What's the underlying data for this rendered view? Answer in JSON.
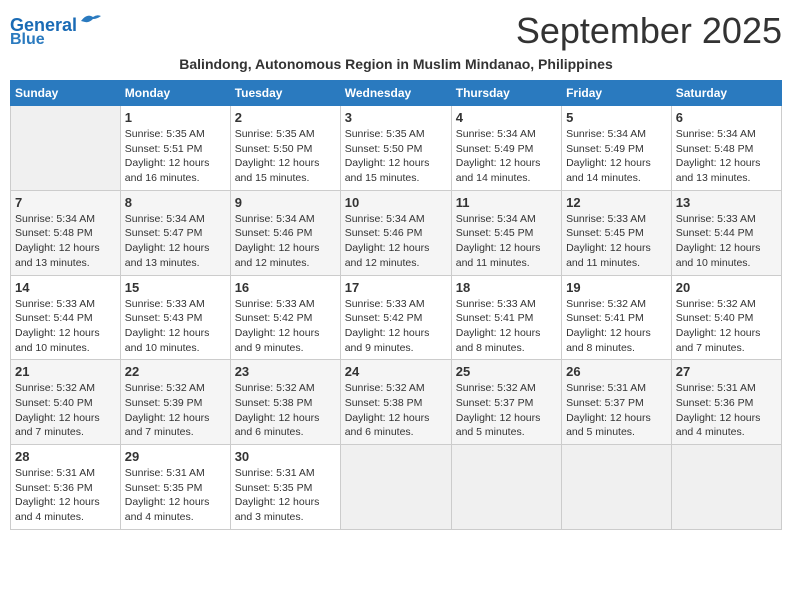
{
  "header": {
    "logo_line1": "General",
    "logo_line2": "Blue",
    "month_title": "September 2025",
    "subtitle": "Balindong, Autonomous Region in Muslim Mindanao, Philippines"
  },
  "weekdays": [
    "Sunday",
    "Monday",
    "Tuesday",
    "Wednesday",
    "Thursday",
    "Friday",
    "Saturday"
  ],
  "weeks": [
    [
      {
        "day": "",
        "info": ""
      },
      {
        "day": "1",
        "info": "Sunrise: 5:35 AM\nSunset: 5:51 PM\nDaylight: 12 hours\nand 16 minutes."
      },
      {
        "day": "2",
        "info": "Sunrise: 5:35 AM\nSunset: 5:50 PM\nDaylight: 12 hours\nand 15 minutes."
      },
      {
        "day": "3",
        "info": "Sunrise: 5:35 AM\nSunset: 5:50 PM\nDaylight: 12 hours\nand 15 minutes."
      },
      {
        "day": "4",
        "info": "Sunrise: 5:34 AM\nSunset: 5:49 PM\nDaylight: 12 hours\nand 14 minutes."
      },
      {
        "day": "5",
        "info": "Sunrise: 5:34 AM\nSunset: 5:49 PM\nDaylight: 12 hours\nand 14 minutes."
      },
      {
        "day": "6",
        "info": "Sunrise: 5:34 AM\nSunset: 5:48 PM\nDaylight: 12 hours\nand 13 minutes."
      }
    ],
    [
      {
        "day": "7",
        "info": "Sunrise: 5:34 AM\nSunset: 5:48 PM\nDaylight: 12 hours\nand 13 minutes."
      },
      {
        "day": "8",
        "info": "Sunrise: 5:34 AM\nSunset: 5:47 PM\nDaylight: 12 hours\nand 13 minutes."
      },
      {
        "day": "9",
        "info": "Sunrise: 5:34 AM\nSunset: 5:46 PM\nDaylight: 12 hours\nand 12 minutes."
      },
      {
        "day": "10",
        "info": "Sunrise: 5:34 AM\nSunset: 5:46 PM\nDaylight: 12 hours\nand 12 minutes."
      },
      {
        "day": "11",
        "info": "Sunrise: 5:34 AM\nSunset: 5:45 PM\nDaylight: 12 hours\nand 11 minutes."
      },
      {
        "day": "12",
        "info": "Sunrise: 5:33 AM\nSunset: 5:45 PM\nDaylight: 12 hours\nand 11 minutes."
      },
      {
        "day": "13",
        "info": "Sunrise: 5:33 AM\nSunset: 5:44 PM\nDaylight: 12 hours\nand 10 minutes."
      }
    ],
    [
      {
        "day": "14",
        "info": "Sunrise: 5:33 AM\nSunset: 5:44 PM\nDaylight: 12 hours\nand 10 minutes."
      },
      {
        "day": "15",
        "info": "Sunrise: 5:33 AM\nSunset: 5:43 PM\nDaylight: 12 hours\nand 10 minutes."
      },
      {
        "day": "16",
        "info": "Sunrise: 5:33 AM\nSunset: 5:42 PM\nDaylight: 12 hours\nand 9 minutes."
      },
      {
        "day": "17",
        "info": "Sunrise: 5:33 AM\nSunset: 5:42 PM\nDaylight: 12 hours\nand 9 minutes."
      },
      {
        "day": "18",
        "info": "Sunrise: 5:33 AM\nSunset: 5:41 PM\nDaylight: 12 hours\nand 8 minutes."
      },
      {
        "day": "19",
        "info": "Sunrise: 5:32 AM\nSunset: 5:41 PM\nDaylight: 12 hours\nand 8 minutes."
      },
      {
        "day": "20",
        "info": "Sunrise: 5:32 AM\nSunset: 5:40 PM\nDaylight: 12 hours\nand 7 minutes."
      }
    ],
    [
      {
        "day": "21",
        "info": "Sunrise: 5:32 AM\nSunset: 5:40 PM\nDaylight: 12 hours\nand 7 minutes."
      },
      {
        "day": "22",
        "info": "Sunrise: 5:32 AM\nSunset: 5:39 PM\nDaylight: 12 hours\nand 7 minutes."
      },
      {
        "day": "23",
        "info": "Sunrise: 5:32 AM\nSunset: 5:38 PM\nDaylight: 12 hours\nand 6 minutes."
      },
      {
        "day": "24",
        "info": "Sunrise: 5:32 AM\nSunset: 5:38 PM\nDaylight: 12 hours\nand 6 minutes."
      },
      {
        "day": "25",
        "info": "Sunrise: 5:32 AM\nSunset: 5:37 PM\nDaylight: 12 hours\nand 5 minutes."
      },
      {
        "day": "26",
        "info": "Sunrise: 5:31 AM\nSunset: 5:37 PM\nDaylight: 12 hours\nand 5 minutes."
      },
      {
        "day": "27",
        "info": "Sunrise: 5:31 AM\nSunset: 5:36 PM\nDaylight: 12 hours\nand 4 minutes."
      }
    ],
    [
      {
        "day": "28",
        "info": "Sunrise: 5:31 AM\nSunset: 5:36 PM\nDaylight: 12 hours\nand 4 minutes."
      },
      {
        "day": "29",
        "info": "Sunrise: 5:31 AM\nSunset: 5:35 PM\nDaylight: 12 hours\nand 4 minutes."
      },
      {
        "day": "30",
        "info": "Sunrise: 5:31 AM\nSunset: 5:35 PM\nDaylight: 12 hours\nand 3 minutes."
      },
      {
        "day": "",
        "info": ""
      },
      {
        "day": "",
        "info": ""
      },
      {
        "day": "",
        "info": ""
      },
      {
        "day": "",
        "info": ""
      }
    ]
  ]
}
